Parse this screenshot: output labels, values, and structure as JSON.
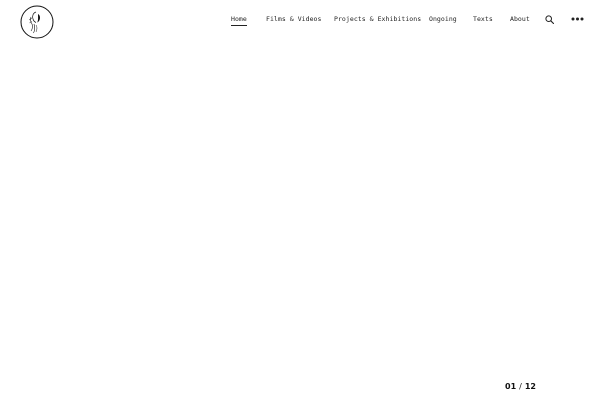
{
  "header": {
    "logo_icon": "circle-portrait-logo-icon",
    "nav": [
      {
        "label": "Home",
        "active": true
      },
      {
        "label": "Films & Videos",
        "active": false
      },
      {
        "label": "Projects & Exhibitions",
        "active": false
      },
      {
        "label": "Ongoing",
        "active": false
      },
      {
        "label": "Texts",
        "active": false
      },
      {
        "label": "About",
        "active": false
      }
    ],
    "search_icon": "search-icon",
    "more_icon": "more-dots-icon"
  },
  "slideshow": {
    "current": "01",
    "separator": "/",
    "total": "12"
  },
  "colors": {
    "text": "#222222",
    "background": "#ffffff"
  }
}
